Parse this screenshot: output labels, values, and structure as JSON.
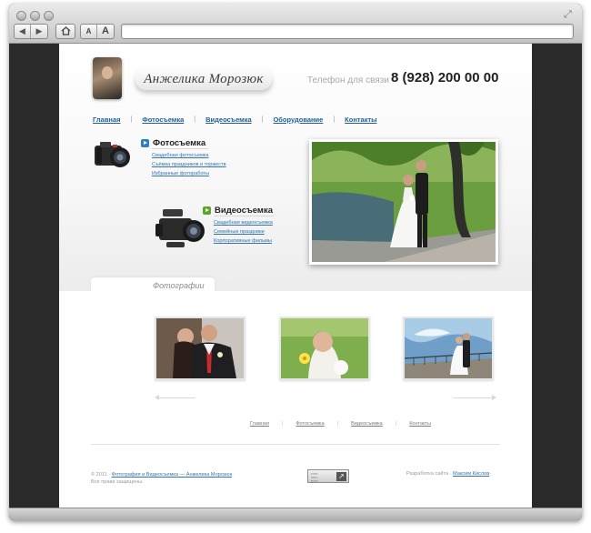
{
  "header": {
    "logo_text": "Анжелика Морозюк",
    "phone_label": "Телефон для связи –",
    "phone_number": "8 (928) 200 00 00"
  },
  "menu": {
    "items": [
      "Главная",
      "Фотосъемка",
      "Видеосъемка",
      "Оборудование",
      "Контакты"
    ]
  },
  "services": {
    "photo": {
      "title": "Фотосъемка",
      "links": [
        "Свадебная фотосъемка",
        "Съёмка праздников и торжеств",
        "Избранные фоторaботы"
      ]
    },
    "video": {
      "title": "Видеосъемка",
      "links": [
        "Свадебная видеосъемка",
        "Семейные праздники",
        "Корпоративные фильмы"
      ]
    }
  },
  "gallery": {
    "tab_label": "Фотографии"
  },
  "footer_menu": {
    "items": [
      "Главная",
      "Фотосъемка",
      "Видеосъемка",
      "Контакты"
    ]
  },
  "footer": {
    "copyright_prefix": "© 2011 ·",
    "copyright_link": "Фотография и Видеосъемка — Анжелика Морозюк",
    "copyright_suffix": "·",
    "rights": "Все права защищены.",
    "developer_prefix": "Разработка сайта ·",
    "developer_link": "Максим Кислов",
    "developer_suffix": "·"
  },
  "colors": {
    "link": "#1f5f99",
    "photo_arrow": "#2e7fc2",
    "video_arrow": "#5aa72c"
  },
  "icons": {
    "back": "triangle-left",
    "forward": "triangle-right",
    "home": "house",
    "font_small": "A",
    "font_large": "A"
  }
}
